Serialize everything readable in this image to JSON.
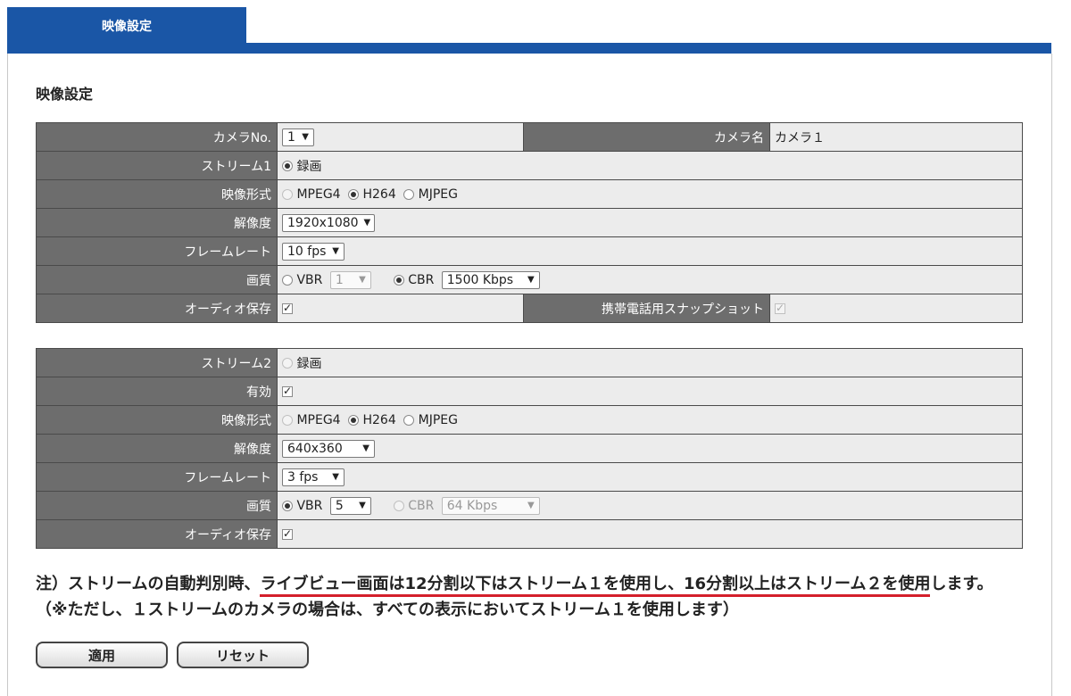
{
  "tab": {
    "label": "映像設定"
  },
  "page_title": "映像設定",
  "stream1": {
    "camera_no_label": "カメラNo.",
    "camera_no_value": "1",
    "camera_name_label": "カメラ名",
    "camera_name_value": "カメラ１",
    "stream_label": "ストリーム1",
    "record_label": "録画",
    "format_label": "映像形式",
    "format_options": [
      "MPEG4",
      "H264",
      "MJPEG"
    ],
    "format_selected": "H264",
    "resolution_label": "解像度",
    "resolution_value": "1920x1080",
    "framerate_label": "フレームレート",
    "framerate_value": "10 fps",
    "quality_label": "画質",
    "vbr_label": "VBR",
    "vbr_value": "1",
    "cbr_label": "CBR",
    "cbr_value": "1500 Kbps",
    "quality_selected": "CBR",
    "audio_label": "オーディオ保存",
    "audio_checked": true,
    "snapshot_label": "携帯電話用スナップショット",
    "snapshot_checked": true
  },
  "stream2": {
    "stream_label": "ストリーム2",
    "record_label": "録画",
    "enabled_label": "有効",
    "enabled_checked": true,
    "format_label": "映像形式",
    "format_options": [
      "MPEG4",
      "H264",
      "MJPEG"
    ],
    "format_selected": "H264",
    "resolution_label": "解像度",
    "resolution_value": "640x360",
    "framerate_label": "フレームレート",
    "framerate_value": "3 fps",
    "quality_label": "画質",
    "vbr_label": "VBR",
    "vbr_value": "5",
    "cbr_label": "CBR",
    "cbr_value": "64 Kbps",
    "quality_selected": "VBR",
    "audio_label": "オーディオ保存",
    "audio_checked": true
  },
  "note": {
    "prefix": "注）ストリームの自動判別時、",
    "underlined": "ライブビュー画面は12分割以下はストリーム１を使用し、16分割以上はストリーム２を使用",
    "suffix": "します。（※ただし、１ストリームのカメラの場合は、すべての表示においてストリーム１を使用します）"
  },
  "buttons": {
    "apply": "適用",
    "reset": "リセット"
  },
  "colors": {
    "tab_blue": "#1a56a6",
    "label_gray": "#6d6d6d",
    "value_gray": "#ececec",
    "note_underline": "#d41f2b"
  }
}
